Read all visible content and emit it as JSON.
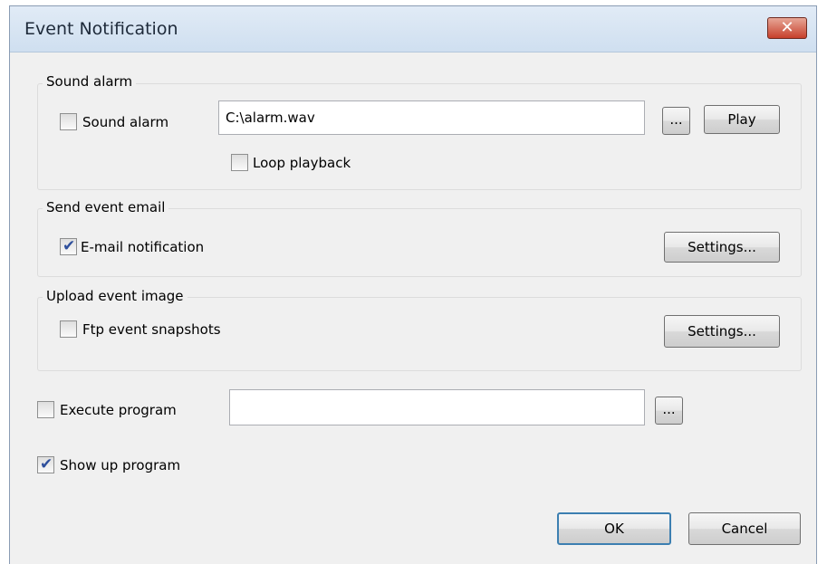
{
  "window": {
    "title": "Event Notification",
    "close_glyph": "✕"
  },
  "sound": {
    "legend": "Sound alarm",
    "checkbox_label": "Sound alarm",
    "checked": false,
    "file_value": "C:\\alarm.wav",
    "browse_label": "...",
    "play_label": "Play",
    "loop_label": "Loop playback",
    "loop_checked": false
  },
  "email": {
    "legend": "Send event email",
    "checkbox_label": "E-mail notification",
    "checked": true,
    "settings_label": "Settings..."
  },
  "upload": {
    "legend": "Upload event image",
    "checkbox_label": "Ftp event snapshots",
    "checked": false,
    "settings_label": "Settings..."
  },
  "execute": {
    "checkbox_label": "Execute program",
    "checked": false,
    "path_value": "",
    "browse_label": "..."
  },
  "showup": {
    "checkbox_label": "Show up program",
    "checked": true
  },
  "footer": {
    "ok_label": "OK",
    "cancel_label": "Cancel"
  }
}
